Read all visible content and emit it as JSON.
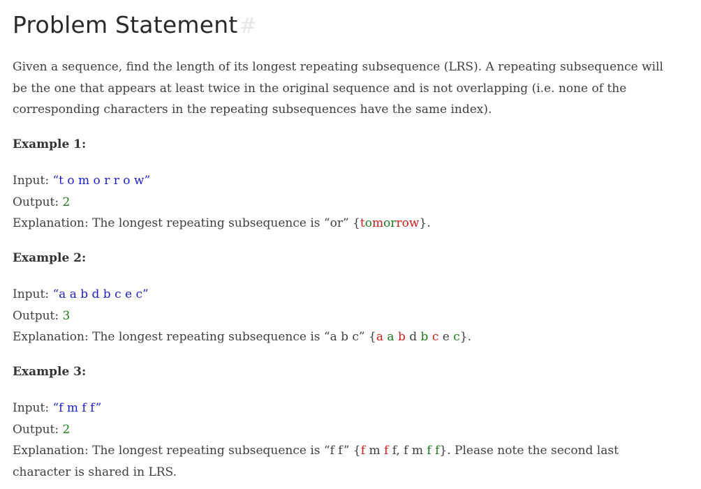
{
  "heading": {
    "title": "Problem Statement",
    "anchor": "#"
  },
  "intro": "Given a sequence, find the length of its longest repeating subsequence (LRS). A repeating subsequence will be the one that appears at least twice in the original sequence and is not overlapping (i.e. none of the corresponding characters in the repeating subsequences have the same index).",
  "examples": [
    {
      "heading": "Example 1:",
      "input_label": "Input: ",
      "input_value": "“t o m o r r o w”",
      "output_label": "Output: ",
      "output_value": "2",
      "explanation_prefix": "Explanation: The longest repeating subsequence is “or” ",
      "explanation_segments": [
        {
          "text": "{",
          "color": "default"
        },
        {
          "text": "t",
          "color": "red"
        },
        {
          "text": "o",
          "color": "green"
        },
        {
          "text": "m",
          "color": "red"
        },
        {
          "text": "o",
          "color": "green"
        },
        {
          "text": "r",
          "color": "green"
        },
        {
          "text": "r",
          "color": "red"
        },
        {
          "text": "ow",
          "color": "red"
        },
        {
          "text": "}.",
          "color": "default"
        }
      ]
    },
    {
      "heading": "Example 2:",
      "input_label": "Input: ",
      "input_value": "“a a b d b c e c”",
      "output_label": "Output: ",
      "output_value": "3",
      "explanation_prefix": "Explanation: The longest repeating subsequence is “a b c” ",
      "explanation_segments": [
        {
          "text": "{",
          "color": "default"
        },
        {
          "text": "a",
          "color": "red"
        },
        {
          "text": " ",
          "color": "default"
        },
        {
          "text": "a",
          "color": "green"
        },
        {
          "text": " ",
          "color": "default"
        },
        {
          "text": "b",
          "color": "red"
        },
        {
          "text": " ",
          "color": "default"
        },
        {
          "text": "d",
          "color": "default"
        },
        {
          "text": " ",
          "color": "default"
        },
        {
          "text": "b",
          "color": "green"
        },
        {
          "text": " ",
          "color": "default"
        },
        {
          "text": "c",
          "color": "red"
        },
        {
          "text": " ",
          "color": "default"
        },
        {
          "text": "e",
          "color": "default"
        },
        {
          "text": " ",
          "color": "default"
        },
        {
          "text": "c",
          "color": "green"
        },
        {
          "text": "}.",
          "color": "default"
        }
      ]
    },
    {
      "heading": "Example 3:",
      "input_label": "Input: ",
      "input_value": "“f m f f”",
      "output_label": "Output: ",
      "output_value": "2",
      "explanation_prefix": "Explanation: The longest repeating subsequence is “f f” ",
      "explanation_segments": [
        {
          "text": "{",
          "color": "default"
        },
        {
          "text": "f",
          "color": "red"
        },
        {
          "text": " m ",
          "color": "default"
        },
        {
          "text": "f",
          "color": "red"
        },
        {
          "text": " ",
          "color": "default"
        },
        {
          "text": "f",
          "color": "default"
        },
        {
          "text": ", f m ",
          "color": "default"
        },
        {
          "text": "f",
          "color": "green"
        },
        {
          "text": " ",
          "color": "default"
        },
        {
          "text": "f",
          "color": "green"
        },
        {
          "text": "}",
          "color": "default"
        },
        {
          "text": ". Please note the second last character is shared in LRS.",
          "color": "default"
        }
      ]
    }
  ],
  "colors": {
    "value_blue": "#1f21c9",
    "output_green": "#1d7a1d",
    "highlight_red": "#cc1d1d",
    "text": "#3f3f3f"
  }
}
